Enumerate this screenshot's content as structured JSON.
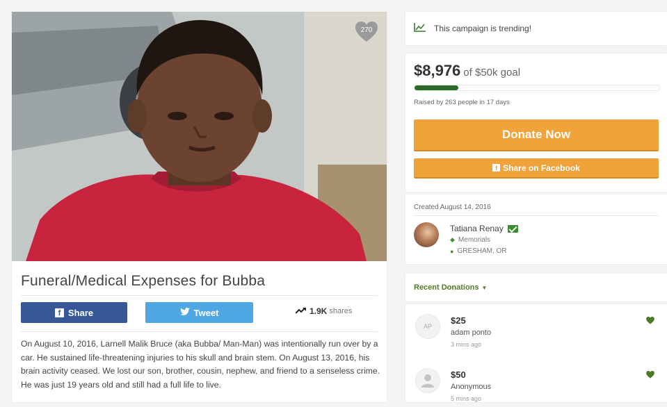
{
  "campaign": {
    "heart_count": "270",
    "title": "Funeral/Medical Expenses for Bubba",
    "share_label": "Share",
    "tweet_label": "Tweet",
    "shares_count": "1.9K",
    "shares_suffix": "shares",
    "story": "On August 10, 2016, Larnell Malik Bruce (aka Bubba/ Man-Man) was intentionally run over by a car. He sustained life-threatening injuries to his skull and brain stem. On August 13, 2016, his brain activity ceased. We lost our son, brother, cousin, nephew, and friend to a senseless crime. He was just 19 years old and still had a full life to live."
  },
  "sidebar": {
    "trending_text": "This campaign is trending!",
    "raised_amount": "$8,976",
    "goal_text": "of $50k goal",
    "progress_fraction": 0.18,
    "raised_by": "Raised by 263 people in 17 days",
    "donate_label": "Donate Now",
    "fb_share_label": "Share on Facebook",
    "created": "Created August 14, 2016",
    "organizer_name": "Tatiana Renay",
    "category": "Memorials",
    "location": "GRESHAM, OR",
    "recent_donations_label": "Recent Donations"
  },
  "donations": [
    {
      "initials": "AP",
      "amount": "$25",
      "donor": "adam ponto",
      "time": "3 mins ago"
    },
    {
      "initials": "",
      "amount": "$50",
      "donor": "Anonymous",
      "time": "5 mins ago"
    }
  ],
  "colors": {
    "accent_green": "#2a6b2a",
    "donate_orange": "#efa33a",
    "facebook_blue": "#365899",
    "twitter_blue": "#4fa7e3"
  }
}
